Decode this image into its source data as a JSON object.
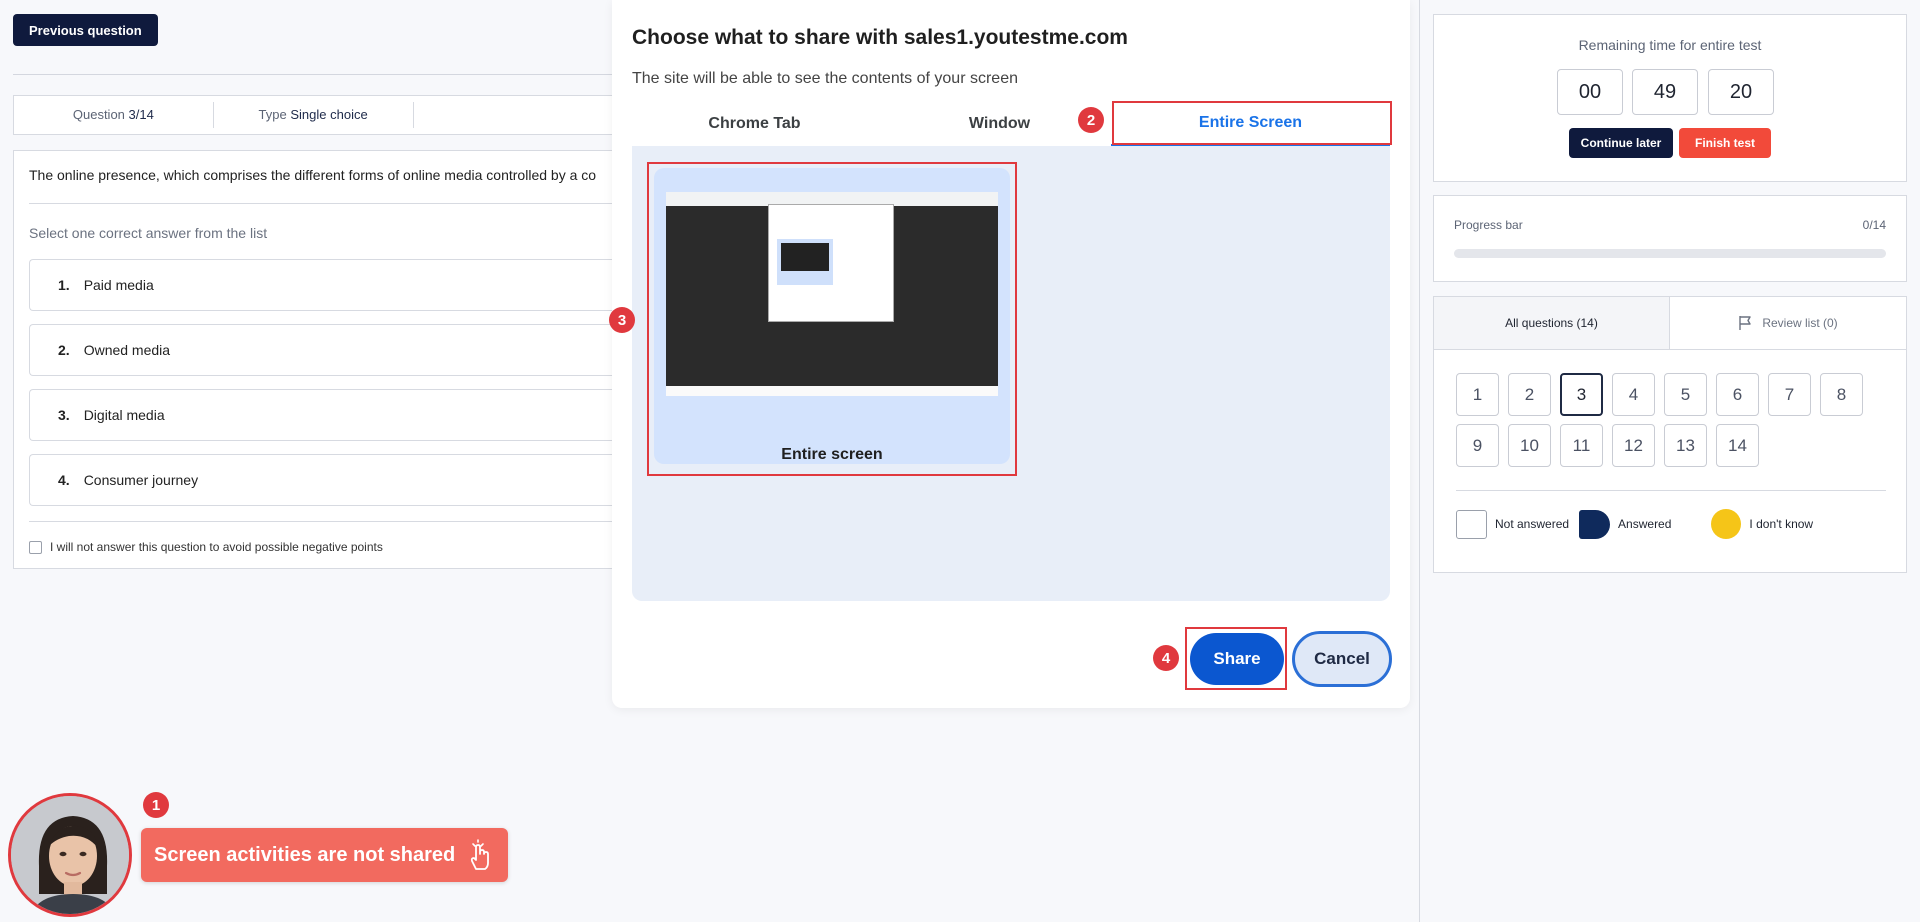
{
  "quiz": {
    "previous_button": "Previous question",
    "question_label": "Question",
    "question_value": "3/14",
    "type_label": "Type",
    "type_value": "Single choice",
    "question_text": "The online presence, which comprises the different forms of online media controlled by a co",
    "instruction": "Select one correct answer from the list",
    "answers": [
      {
        "num": "1.",
        "text": "Paid media"
      },
      {
        "num": "2.",
        "text": "Owned media"
      },
      {
        "num": "3.",
        "text": "Digital media"
      },
      {
        "num": "4.",
        "text": "Consumer journey"
      }
    ],
    "skip_label": "I will not answer this question to avoid possible negative points"
  },
  "share_dialog": {
    "title": "Choose what to share with sales1.youtestme.com",
    "subtitle": "The site will be able to see the contents of your screen",
    "tabs": [
      "Chrome Tab",
      "Window",
      "Entire Screen"
    ],
    "active_tab": "Entire Screen",
    "thumbnail_label": "Entire screen",
    "share_button": "Share",
    "cancel_button": "Cancel"
  },
  "annotations": {
    "badge_1": "1",
    "badge_2": "2",
    "badge_3": "3",
    "badge_4": "4",
    "color": "#e0393e"
  },
  "timer": {
    "title": "Remaining time for entire test",
    "hours": "00",
    "minutes": "49",
    "seconds": "20",
    "continue_button": "Continue later",
    "finish_button": "Finish test"
  },
  "progress": {
    "label": "Progress bar",
    "count": "0/14",
    "fraction": 0
  },
  "questions_nav": {
    "all_tab": "All questions (14)",
    "review_tab": "Review list (0)",
    "numbers": [
      "1",
      "2",
      "3",
      "4",
      "5",
      "6",
      "7",
      "8",
      "9",
      "10",
      "11",
      "12",
      "13",
      "14"
    ],
    "current": "3",
    "legend": {
      "not_answered": "Not answered",
      "answered": "Answered",
      "dont_know": "I don't know"
    }
  },
  "proctoring": {
    "toast": "Screen activities are not shared"
  },
  "colors": {
    "navy": "#0f1a3d",
    "finish_red": "#f24a3a",
    "chrome_blue": "#1a73e8",
    "toast_red": "#f26a5f"
  }
}
